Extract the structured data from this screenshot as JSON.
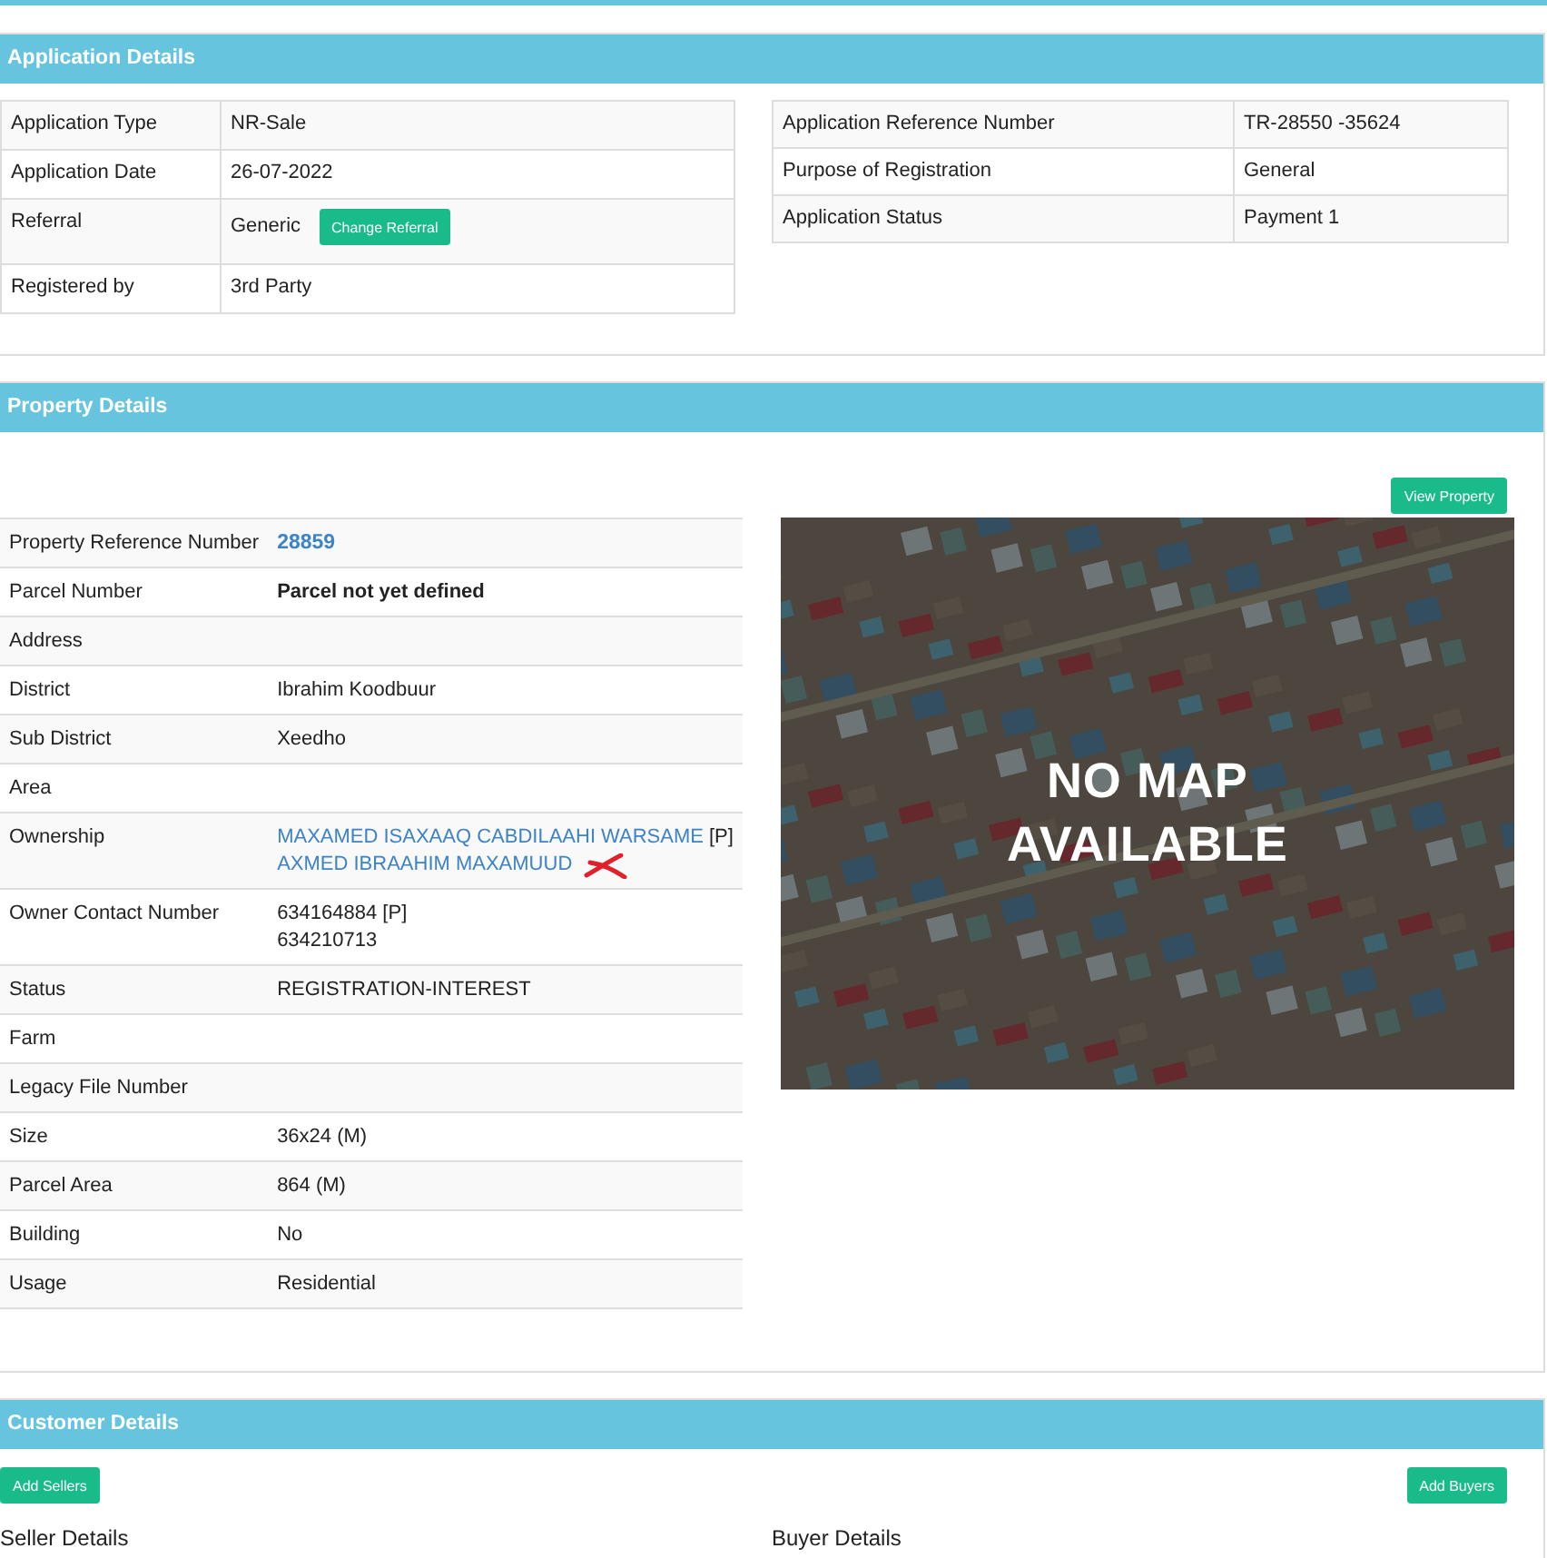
{
  "application": {
    "title": "Application Details",
    "left_rows": [
      {
        "label": "Application Type",
        "kind": "text",
        "value": "NR-Sale"
      },
      {
        "label": "Application Date",
        "kind": "text",
        "value": "26-07-2022"
      },
      {
        "label": "Referral",
        "kind": "button",
        "value": "Generic",
        "button": "Change Referral"
      },
      {
        "label": "Registered by",
        "kind": "text",
        "value": "3rd Party"
      }
    ],
    "right_rows": [
      {
        "label": "Application Reference Number",
        "value": "TR-28550 -35624"
      },
      {
        "label": "Purpose of Registration",
        "value": "General"
      },
      {
        "label": "Application Status",
        "value": "Payment 1"
      }
    ]
  },
  "property": {
    "title": "Property Details",
    "button": "View Property",
    "map_message": [
      "NO MAP",
      "AVAILABLE"
    ],
    "rows": [
      {
        "label": "Property Reference Number",
        "kind": "link",
        "value": "28859"
      },
      {
        "label": "Parcel Number",
        "kind": "bold",
        "value": "Parcel not yet defined"
      },
      {
        "label": "Address",
        "kind": "text"
      },
      {
        "label": "District",
        "kind": "text",
        "value": "Ibrahim Koodbuur"
      },
      {
        "label": "Sub District",
        "kind": "text",
        "value": "Xeedho"
      },
      {
        "label": "Area",
        "kind": "text"
      },
      {
        "label": "Ownership",
        "kind": "owners",
        "owners": [
          {
            "name": "MAXAMED ISAXAAQ CABDILAAHI WARSAME",
            "tag": "[P]",
            "marked": false
          },
          {
            "name": "AXMED IBRAAHIM MAXAMUUD",
            "marked": true
          }
        ]
      },
      {
        "label": "Owner Contact Number",
        "kind": "lines",
        "lines": [
          "634164884 [P]",
          "634210713"
        ]
      },
      {
        "label": "Status",
        "kind": "text",
        "value": "REGISTRATION-INTEREST"
      },
      {
        "label": "Farm",
        "kind": "text"
      },
      {
        "label": "Legacy File Number",
        "kind": "text"
      },
      {
        "label": "Size",
        "kind": "text",
        "value": "36x24 (M)"
      },
      {
        "label": "Parcel Area",
        "kind": "text",
        "value": "864 (M)"
      },
      {
        "label": "Building",
        "kind": "text",
        "value": "No"
      },
      {
        "label": "Usage",
        "kind": "text",
        "value": "Residential"
      }
    ]
  },
  "customer": {
    "title": "Customer Details",
    "sellers_button": "Add Sellers",
    "buyers_button": "Add Buyers",
    "seller_heading": "Seller Details",
    "buyer_heading": "Buyer Details"
  }
}
